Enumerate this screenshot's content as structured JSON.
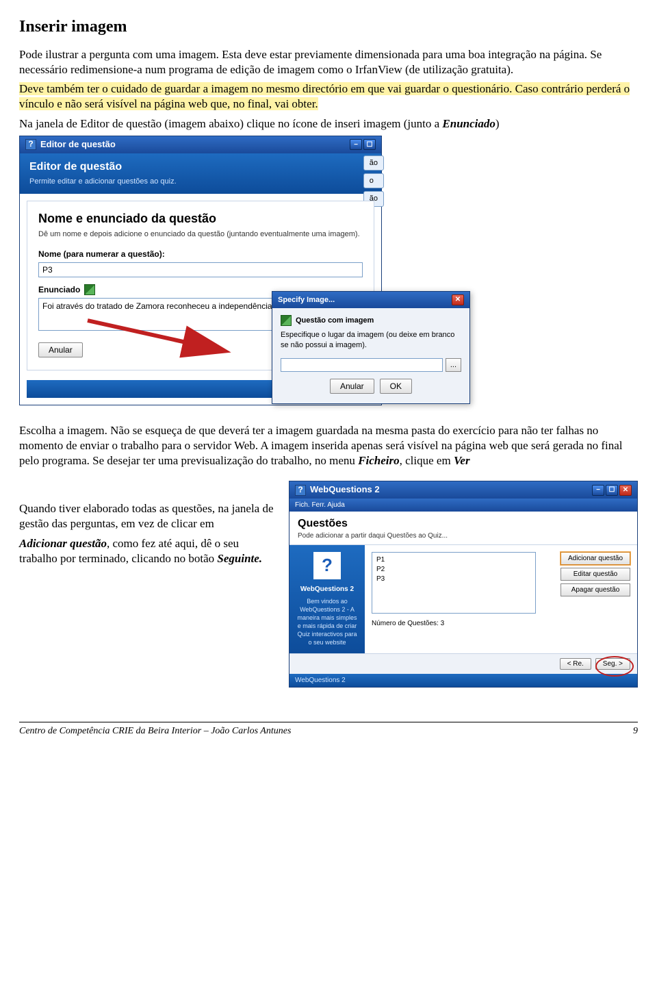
{
  "heading": "Inserir imagem",
  "intro": {
    "p1": "Pode ilustrar a pergunta com uma imagem. Esta deve estar previamente dimensionada para uma boa integração na página. Se necessário redimensione-a num programa de edição de imagem como o IrfanView (de utilização gratuita).",
    "p2_hl": "Deve também ter o cuidado de guardar a imagem no mesmo directório em que vai guardar o questionário. Caso contrário perderá o vínculo e não será visível na página web que, no final, vai obter.",
    "p3a": "Na janela de Editor de questão (imagem abaixo) clique no ícone de inseri imagem (junto a ",
    "p3b": ")",
    "enunciado_word": "Enunciado"
  },
  "editor": {
    "title": "Editor de questão",
    "banner_title": "Editor de questão",
    "banner_sub": "Permite editar e adicionar questões ao quiz.",
    "panel_title": "Nome e enunciado da questão",
    "panel_sub": "Dê um nome e depois adicione o enunciado da questão (juntando eventualmente uma imagem).",
    "name_label": "Nome (para numerar a questão):",
    "name_value": "P3",
    "enun_label": "Enunciado",
    "enun_value": "Foi através do tratado de Zamora reconheceu a independência do Co",
    "anular": "Anular",
    "tabs": [
      "ão",
      "o",
      "ão"
    ]
  },
  "specify": {
    "title": "Specify Image...",
    "heading": "Questão com imagem",
    "text": "Especifique o lugar da imagem (ou deixe em branco se não possui a imagem).",
    "browse": "...",
    "anular": "Anular",
    "ok": "OK"
  },
  "mid": {
    "p1": "Escolha a imagem. Não se esqueça de que deverá ter a imagem guardada na mesma pasta do exercício para  não ter falhas no momento de enviar o trabalho para o servidor Web. A imagem inserida apenas será visível na página web que será gerada no final pelo programa. Se desejar ter uma previsualização do trabalho, no menu ",
    "ficheiro": "Ficheiro",
    "p2": ", clique em ",
    "ver": "Ver"
  },
  "left": {
    "p1": "Quando tiver elaborado todas as questões, na janela de gestão das perguntas, em vez de clicar em",
    "adicionar": "Adicionar questão",
    "p2": ", como fez até aqui, dê o seu trabalho por terminado, clicando no botão ",
    "seguinte": "Seguinte."
  },
  "wq": {
    "title": "WebQuestions 2",
    "menu": "Fich.   Ferr.   Ajuda",
    "banner_title": "Questões",
    "banner_sub": "Pode adicionar a partir daqui Questões ao Quiz...",
    "side_title": "WebQuestions 2",
    "side_text": "Bem vindos ao WebQuestions 2 - A maneira mais simples e mais rápida de criar Quiz interactivos para o seu website",
    "list": [
      "P1",
      "P2",
      "P3"
    ],
    "btn_add": "Adicionar questão",
    "btn_edit": "Editar questão",
    "btn_del": "Apagar questão",
    "count": "Número de Questões: 3",
    "back": "< Re.",
    "next": "Seg. >",
    "status": "WebQuestions 2"
  },
  "footer": {
    "left": "Centro de Competência CRIE da Beira Interior – João Carlos Antunes",
    "right": "9"
  }
}
